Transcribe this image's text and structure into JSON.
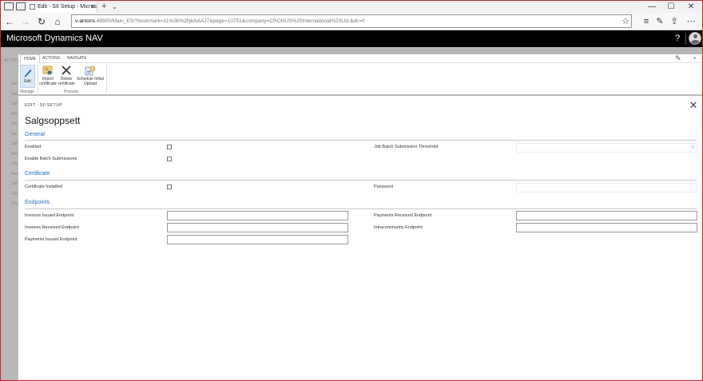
{
  "browser": {
    "tab_title": "Edit - SII Setup - Micros",
    "tab_close": "✕",
    "new_tab": "+",
    "tab_menu": "⌄",
    "minimize": "—",
    "maximize": "☐",
    "close": "✕",
    "back": "←",
    "forward": "→",
    "refresh": "↻",
    "home": "⌂",
    "address_host": "v-antons",
    "address_path": ":48900/Main_ES/?bookmark=11%3b%2fykAAAJ7&page=10751&company=CRONUS%20International%20Ltd.&dc=0",
    "tools": {
      "favorite": "☆",
      "hub": "≡",
      "notes": "✎",
      "share": "⇪",
      "more": "⋯"
    }
  },
  "app": {
    "title": "Microsoft Dynamics NAV",
    "help": "?"
  },
  "background": {
    "actions_label": "ACTIONS",
    "side_items": [
      "Sal",
      "Sal",
      "Sal",
      "Blo",
      "Sal",
      "Sal",
      "Sal",
      "Ret",
      "Cor",
      "Ret",
      "Sal",
      "Cor",
      "Tra"
    ]
  },
  "ribbon": {
    "tabs": [
      "HOME",
      "ACTIONS",
      "NAVIGATE"
    ],
    "buttons": {
      "edit": "Edit",
      "import_l1": "Import",
      "import_l2": "certificate",
      "delete_l1": "Delete",
      "delete_l2": "certificate",
      "schedule_l1": "Schedule Initial",
      "schedule_l2": "Upload"
    },
    "groups": {
      "manage": "Manage",
      "process": "Process"
    }
  },
  "card": {
    "breadcrumb": "EDIT - SII SETUP",
    "title": "Salgsoppsett",
    "sections": {
      "general": "General",
      "certificate": "Certificate",
      "endpoints": "Endpoints"
    },
    "fields": {
      "enabled": "Enabled",
      "enable_batch": "Enable Batch Submissions",
      "job_batch_threshold": "Job Batch Submission Threshold",
      "job_batch_value": "0",
      "certificate_installed": "Certificate Installed",
      "password": "Password",
      "invoices_issued": "Invoices Issued Endpoint",
      "invoices_received": "Invoices Received Endpoint",
      "payments_issued": "Payments Issued Endpoint",
      "payments_received": "Payments Received Endpoint",
      "intracommunity": "Intracommunity Endpoint"
    },
    "values": {
      "invoices_issued": "",
      "invoices_received": "",
      "payments_issued": "",
      "payments_received": "",
      "intracommunity": "",
      "password": ""
    },
    "close": "✕"
  },
  "colors": {
    "accent": "#1f6fb7",
    "window_border": "#d0202a",
    "app_bar": "#000000"
  }
}
